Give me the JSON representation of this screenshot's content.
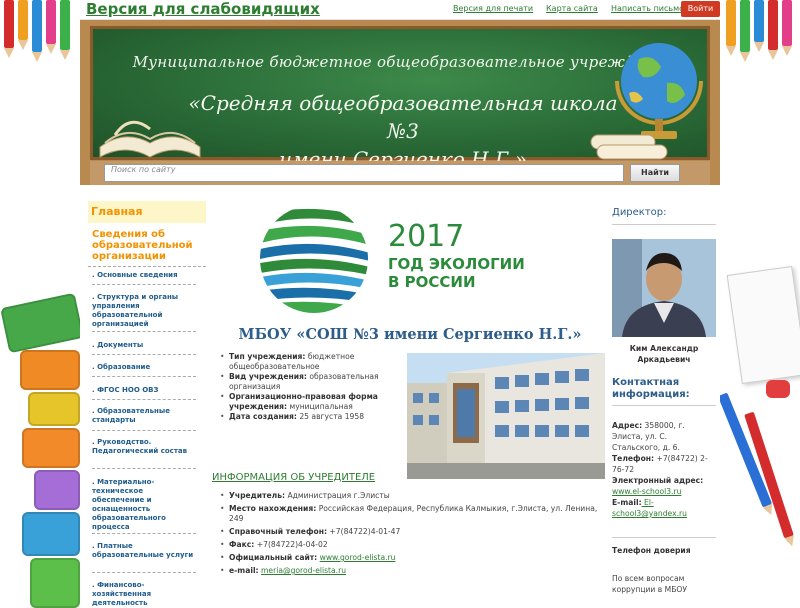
{
  "topbar": {
    "vision_link": "Версия для слабовидящих",
    "print_link": "Версия для печати",
    "sitemap_link": "Карта сайта",
    "write_link": "Написать письмо",
    "logout_button": "Войти"
  },
  "header": {
    "school_type": "Муниципальное бюджетное общеобразовательное учреждение",
    "school_name_line1": "«Средняя общеобразовательная школа №3",
    "school_name_line2": "имени Сергиенко Н.Г.»",
    "search_placeholder": "Поиск по сайту",
    "search_button": "Найти"
  },
  "leftnav": {
    "home": "Главная",
    "section": "Сведения об образовательной организации",
    "items": [
      ". Основные сведения",
      ". Структура и органы управления образовательной организацией",
      ". Документы",
      ". Образование",
      ". ФГОС НОО ОВЗ",
      ". Образовательные стандарты",
      ". Руководство. Педагогический состав",
      ". Материально-техническое обеспечение и оснащенность образовательного процесса",
      ". Платные образовательные услуги",
      ". Финансово-хозяйственная деятельность"
    ]
  },
  "banner": {
    "year": "2017",
    "line1": "ГОД ЭКОЛОГИИ",
    "line2": "В РОССИИ"
  },
  "main": {
    "org_title": "МБОУ «СОШ №3 имени Сергиенко Н.Г.»",
    "info": [
      {
        "label": "Тип учреждения:",
        "value": " бюджетное общеобразовательное"
      },
      {
        "label": "Вид учреждения:",
        "value": " образовательная организация"
      },
      {
        "label": "Организационно-правовая форма учреждения:",
        "value": " муниципальная"
      },
      {
        "label": "Дата создания:",
        "value": " 25 августа 1958"
      }
    ],
    "founder_heading": "ИНФОРМАЦИЯ ОБ УЧРЕДИТЕЛЕ",
    "founder": {
      "founder_label": "Учредитель:",
      "founder_value": " Администрация г.Элисты",
      "location_label": "Место нахождения:",
      "location_value": " Российская Федерация, Республика Калмыкия, г.Элиста, ул. Ленина, 249",
      "phone_label": "Справочный телефон:",
      "phone_value": " +7(84722)4-01-47",
      "fax_label": "Факс:",
      "fax_value": " +7(84722)4-04-02",
      "site_label": "Официальный сайт:",
      "site_value": "www.gorod-elista.ru",
      "email_label": "e-mail:",
      "email_value": "meria@gorod-elista.ru"
    }
  },
  "rightbar": {
    "director_heading": "Директор:",
    "director_name_line1": "Ким Александр",
    "director_name_line2": "Аркадьевич",
    "contact_heading": "Контактная информация:",
    "address_label": "Адрес:",
    "address_value": " 358000, г. Элиста, ул. С. Стальского, д. 6.",
    "phone_label": "Телефон:",
    "phone_value": " +7(84722) 2-76-72",
    "email_heading": "Электронный адрес:",
    "site": "www.el-school3.ru",
    "email_label": "E-mail:",
    "email_value": " El-school3@yandex.ru",
    "trust_heading": "Телефон доверия",
    "trust_text": "По всем вопросам коррупции в МБОУ"
  },
  "colors": {
    "accent_green": "#2e7d32",
    "nav_orange": "#f39200",
    "heading_blue": "#2d5d8a",
    "logout_red": "#d13a22"
  }
}
